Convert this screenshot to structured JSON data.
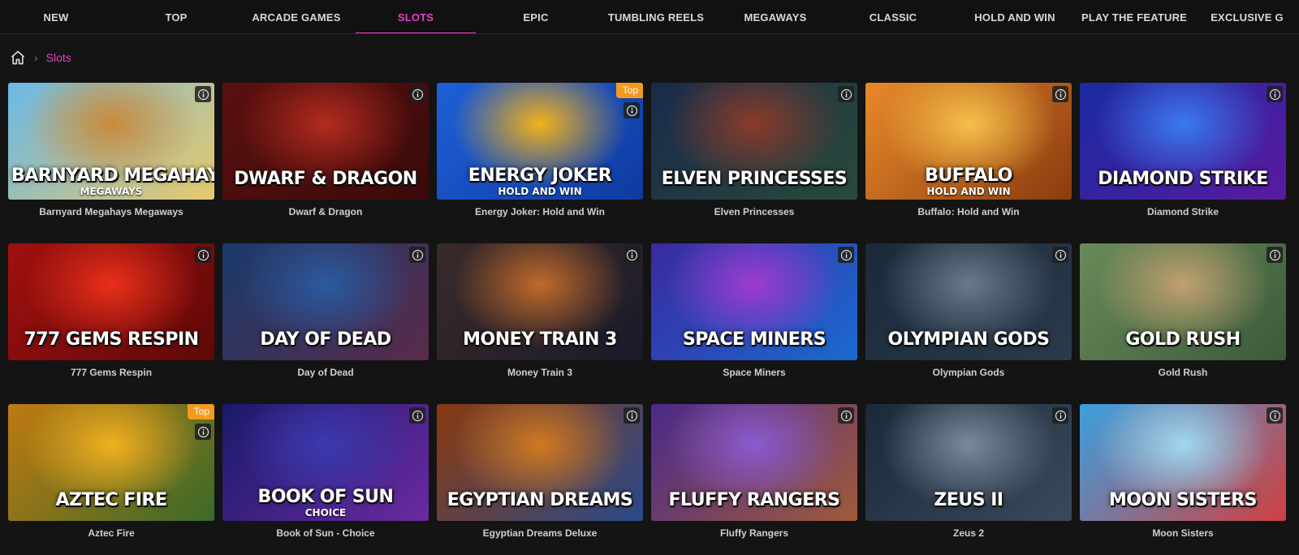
{
  "nav": {
    "items": [
      "NEW",
      "TOP",
      "ARCADE GAMES",
      "SLOTS",
      "EPIC",
      "TUMBLING REELS",
      "MEGAWAYS",
      "CLASSIC",
      "HOLD AND WIN",
      "PLAY THE FEATURE",
      "EXCLUSIVE G"
    ],
    "active_index": 3,
    "active_color": "#e83fcf"
  },
  "breadcrumb": {
    "home_icon": "home-icon",
    "current": "Slots"
  },
  "games": [
    {
      "name": "Barnyard Megahays Megaways",
      "art_title": "BARNYARD MEGAHAYS",
      "art_sub": "MEGAWAYS",
      "badge": "",
      "colors": [
        "#6bb8e6",
        "#c98a3b",
        "#e8c96a"
      ]
    },
    {
      "name": "Dwarf & Dragon",
      "art_title": "DWARF & DRAGON",
      "art_sub": "",
      "badge": "",
      "colors": [
        "#5a1010",
        "#b32b1e",
        "#3a0a0a"
      ]
    },
    {
      "name": "Energy Joker: Hold and Win",
      "art_title": "ENERGY JOKER",
      "art_sub": "HOLD AND WIN",
      "badge": "Top",
      "colors": [
        "#1e5fd8",
        "#f2b21b",
        "#0f3aa0"
      ]
    },
    {
      "name": "Elven Princesses",
      "art_title": "ELVEN PRINCESSES",
      "art_sub": "",
      "badge": "",
      "colors": [
        "#1a2a4a",
        "#8a3a2a",
        "#2a4a3a"
      ]
    },
    {
      "name": "Buffalo: Hold and Win",
      "art_title": "BUFFALO",
      "art_sub": "HOLD AND WIN",
      "badge": "",
      "colors": [
        "#e88a2a",
        "#f5c04a",
        "#8a3a10"
      ]
    },
    {
      "name": "Diamond Strike",
      "art_title": "DIAMOND STRIKE",
      "art_sub": "",
      "badge": "",
      "colors": [
        "#1a2aa0",
        "#3a7af0",
        "#5a1aa0"
      ]
    },
    {
      "name": "777 Gems Respin",
      "art_title": "777 GEMS RESPIN",
      "art_sub": "",
      "badge": "",
      "colors": [
        "#a01010",
        "#e8301a",
        "#600808"
      ]
    },
    {
      "name": "Day of Dead",
      "art_title": "DAY OF DEAD",
      "art_sub": "",
      "badge": "",
      "colors": [
        "#1a3a6a",
        "#2a5aa0",
        "#5a2a4a"
      ]
    },
    {
      "name": "Money Train 3",
      "art_title": "MONEY TRAIN 3",
      "art_sub": "",
      "badge": "",
      "colors": [
        "#3a2a2a",
        "#c06a2a",
        "#1a1a2a"
      ]
    },
    {
      "name": "Space Miners",
      "art_title": "SPACE MINERS",
      "art_sub": "",
      "badge": "",
      "colors": [
        "#3a2aa0",
        "#a03ad0",
        "#1a6ad0"
      ]
    },
    {
      "name": "Olympian Gods",
      "art_title": "OLYMPIAN GODS",
      "art_sub": "",
      "badge": "",
      "colors": [
        "#1a2a3a",
        "#6a7a8a",
        "#2a3a4a"
      ]
    },
    {
      "name": "Gold Rush",
      "art_title": "GOLD RUSH",
      "art_sub": "",
      "badge": "",
      "colors": [
        "#6a8a5a",
        "#c0a070",
        "#3a5a3a"
      ]
    },
    {
      "name": "Aztec Fire",
      "art_title": "AZTEC FIRE",
      "art_sub": "",
      "badge": "Top",
      "colors": [
        "#c07a10",
        "#f0b020",
        "#3a6a2a"
      ]
    },
    {
      "name": "Book of Sun - Choice",
      "art_title": "BOOK OF SUN",
      "art_sub": "CHOICE",
      "badge": "",
      "colors": [
        "#1a1a6a",
        "#3a3ab0",
        "#6a2aa0"
      ]
    },
    {
      "name": "Egyptian Dreams Deluxe",
      "art_title": "EGYPTIAN DREAMS",
      "art_sub": "",
      "badge": "",
      "colors": [
        "#8a3a10",
        "#d07a20",
        "#2a4a8a"
      ]
    },
    {
      "name": "Fluffy Rangers",
      "art_title": "FLUFFY RANGERS",
      "art_sub": "",
      "badge": "",
      "colors": [
        "#4a2a8a",
        "#8a5ad0",
        "#a05a3a"
      ]
    },
    {
      "name": "Zeus 2",
      "art_title": "ZEUS II",
      "art_sub": "",
      "badge": "",
      "colors": [
        "#1a2a3a",
        "#7a8a9a",
        "#3a4a5a"
      ]
    },
    {
      "name": "Moon Sisters",
      "art_title": "MOON SISTERS",
      "art_sub": "",
      "badge": "",
      "colors": [
        "#3aa0e0",
        "#a0d8f0",
        "#d04040"
      ]
    }
  ]
}
